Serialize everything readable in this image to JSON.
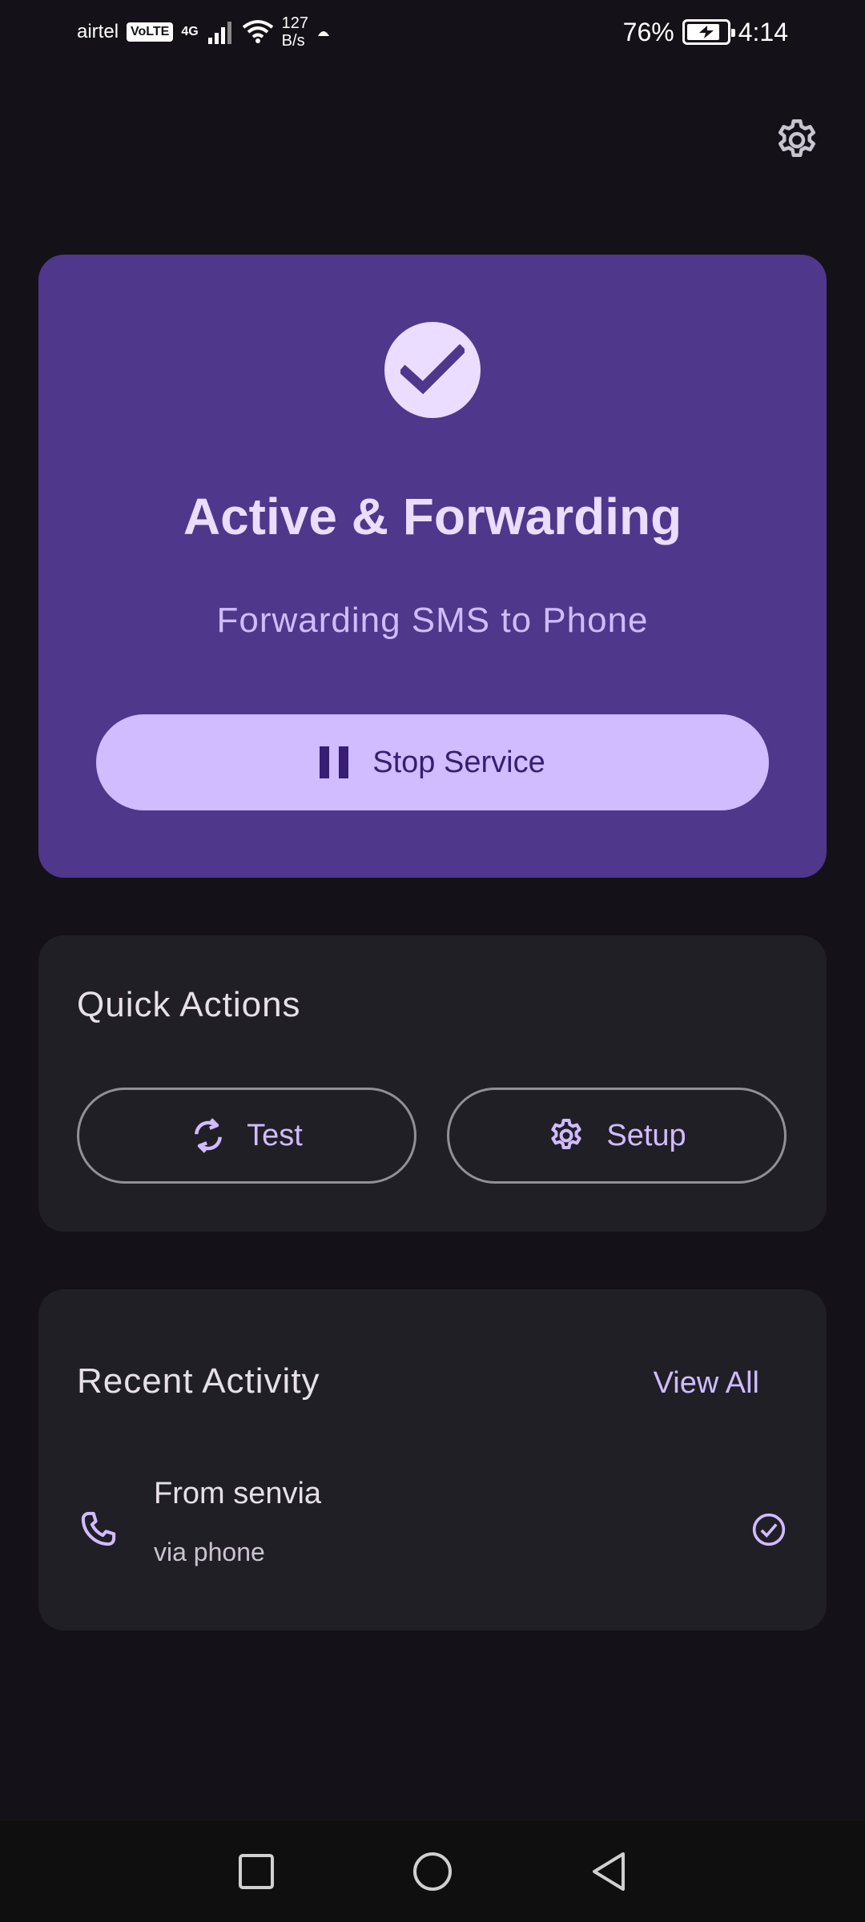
{
  "status_bar": {
    "carrier": "airtel",
    "volte": "VoLTE",
    "network": "4G",
    "speed_value": "127",
    "speed_unit": "B/s",
    "battery": "76%",
    "time": "4:14"
  },
  "icons": {
    "settings": "gear-icon",
    "status": "check-icon",
    "stop": "pause-icon",
    "test": "sync-icon",
    "setup": "gear-icon",
    "activity": "phone-icon",
    "activity_status": "check-circle-icon"
  },
  "status_card": {
    "title": "Active & Forwarding",
    "subtitle": "Forwarding SMS to Phone",
    "stop_label": "Stop Service"
  },
  "quick_actions": {
    "title": "Quick Actions",
    "test_label": "Test",
    "setup_label": "Setup"
  },
  "recent_activity": {
    "title": "Recent Activity",
    "view_all": "View All",
    "items": [
      {
        "from": "From senvia",
        "via": "via phone"
      }
    ]
  },
  "colors": {
    "background": "#141218",
    "primary_container": "#4F378B",
    "primary": "#D0BCFF",
    "surface": "#211F26"
  }
}
